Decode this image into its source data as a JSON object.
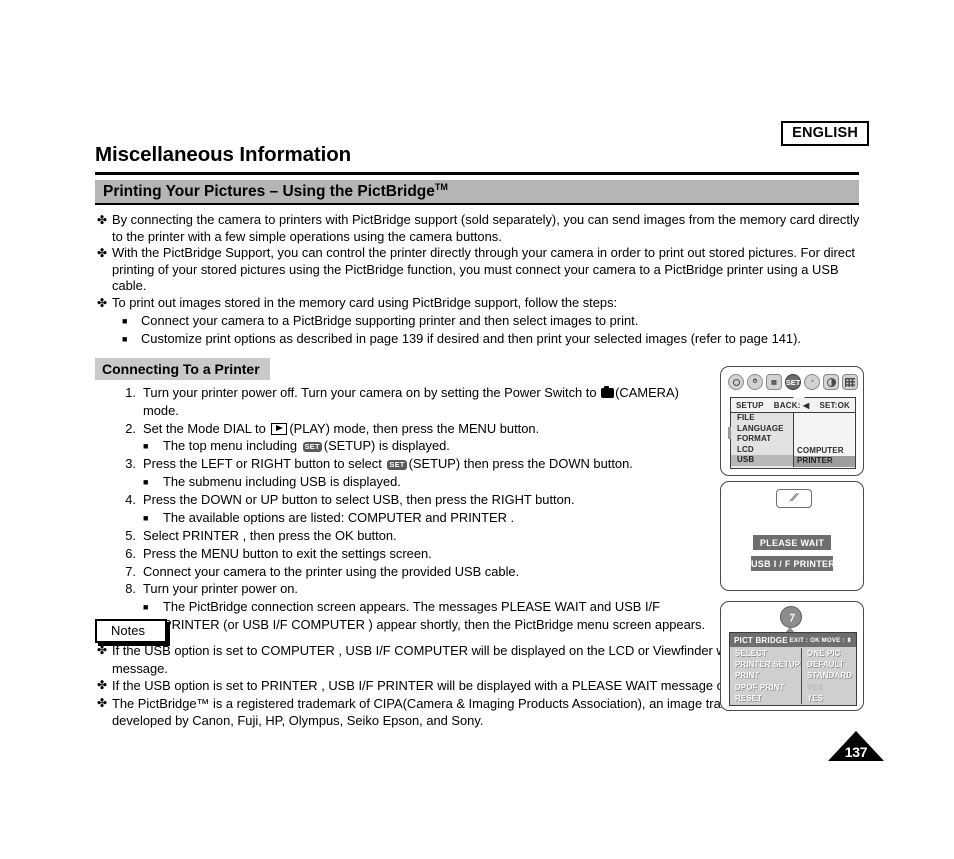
{
  "header": {
    "language_badge": "ENGLISH",
    "page_title": "Miscellaneous Information"
  },
  "section": {
    "title": "Printing Your Pictures – Using the PictBridge",
    "title_tm": "TM",
    "bg_color": "#b5b5b5"
  },
  "intro_bullets": [
    {
      "glyph": "✤",
      "text": "By connecting the camera to printers with PictBridge support (sold separately), you can send images from the memory card directly to the printer with a few simple operations using the camera buttons."
    },
    {
      "glyph": "✤",
      "text": "With the PictBridge Support, you can control the printer directly through your camera in order to print out stored pictures. For direct printing of your stored pictures using the PictBridge function, you must connect your camera to a PictBridge printer using a USB cable."
    },
    {
      "glyph": "✤",
      "text": "To print out images stored in the memory card using PictBridge support, follow the steps:"
    }
  ],
  "intro_subitems": [
    {
      "glyph": "■",
      "text": "Connect your camera to a PictBridge supporting printer and then select images to print."
    },
    {
      "glyph": "■",
      "text": "Customize print options as described in page 139 if desired and then print your selected images (refer to page 141)."
    }
  ],
  "subsection": {
    "title": "Connecting To a Printer",
    "bg_color": "#c9c9c9"
  },
  "steps": [
    {
      "num": "1.",
      "text_before": "Turn your printer power off. Turn your camera on by setting the Power Switch to ",
      "icon": "camera-icon",
      "text_after": "(CAMERA) mode."
    },
    {
      "num": "2.",
      "text_before": "Set the Mode DIAL to ",
      "icon": "play-icon",
      "text_after": "(PLAY) mode, then press the MENU button."
    },
    {
      "num": "3.",
      "text_before": "Press the LEFT or RIGHT button to select ",
      "icon": "set-icon",
      "text_after": "(SETUP) then press the DOWN button."
    },
    {
      "num": "4.",
      "text_before": "Press the DOWN or UP button to select USB, then press the RIGHT button.",
      "icon": "",
      "text_after": ""
    },
    {
      "num": "5.",
      "text_before": "Select  PRINTER , then press the OK button.",
      "icon": "",
      "text_after": ""
    },
    {
      "num": "6.",
      "text_before": "Press the MENU button to exit the settings screen.",
      "icon": "",
      "text_after": ""
    },
    {
      "num": "7.",
      "text_before": "Connect your camera to the printer using the provided USB cable.",
      "icon": "",
      "text_after": ""
    },
    {
      "num": "8.",
      "text_before": "Turn your printer power on.",
      "icon": "",
      "text_after": ""
    }
  ],
  "step_subitems": {
    "after_step2": {
      "glyph": "■",
      "text_before": "The top menu including ",
      "icon": "set-icon",
      "text_after": "(SETUP) is displayed."
    },
    "after_step3": {
      "glyph": "■",
      "text": "The submenu including  USB  is displayed."
    },
    "after_step4": {
      "glyph": "■",
      "text": "The available options are listed:  COMPUTER  and  PRINTER ."
    },
    "after_step8": {
      "glyph": "■",
      "text": "The PictBridge connection screen appears. The messages  PLEASE WAIT  and  USB I/F PRINTER  (or  USB I/F COMPUTER ) appear shortly, then the PictBridge menu screen appears."
    }
  },
  "notes": {
    "label": "Notes",
    "items": [
      {
        "glyph": "✤",
        "text": "If the USB option is set to  COMPUTER ,  USB I/F COMPUTER  will be displayed on the LCD or Viewfinder with a  PLEASE WAIT  message."
      },
      {
        "glyph": "✤",
        "text": "If the USB option is set to  PRINTER ,  USB I/F PRINTER  will be displayed with a  PLEASE WAIT  message on the LCD or Viewfinder."
      },
      {
        "glyph": "✤",
        "text": "The PictBridge™ is a registered trademark of CIPA(Camera & Imaging Products Association), an image transfer standard developed by Canon, Fuji, HP, Olympus, Seiko Epson, and Sony."
      }
    ]
  },
  "lcd_setup": {
    "icons": [
      "camera-icon",
      "timer-icon",
      "card-icon",
      "set-icon",
      "person-icon",
      "brightness-icon",
      "grid-icon"
    ],
    "selected_icon": "SET",
    "header_title": "SETUP",
    "header_back": "BACK: ◀",
    "header_set": "SET:OK",
    "left_items": [
      "FILE",
      "LANGUAGE",
      "FORMAT",
      "LCD",
      "USB"
    ],
    "left_highlighted": "USB",
    "right_items": [
      "COMPUTER",
      "PRINTER"
    ],
    "right_highlighted": "PRINTER"
  },
  "lcd_wait": {
    "tab_glyph": "⁄⁄",
    "message_1": "PLEASE WAIT",
    "message_2": "USB I / F PRINTER"
  },
  "lcd_pict": {
    "badge_glyph": "⁊",
    "header_title": "PICT BRIDGE",
    "header_exit": "EXIT : OK",
    "header_move": "MOVE : ⬍",
    "left_items": [
      "SELECT",
      "PRINTER SETUP",
      "PRINT",
      "DPOF PRINT",
      "RESET"
    ],
    "right_items": [
      "ONE PIC",
      "DEFAULT",
      "STANDARD",
      "YES",
      "YES"
    ],
    "right_dimmed_index": 3
  },
  "footer": {
    "page_number": "137"
  }
}
